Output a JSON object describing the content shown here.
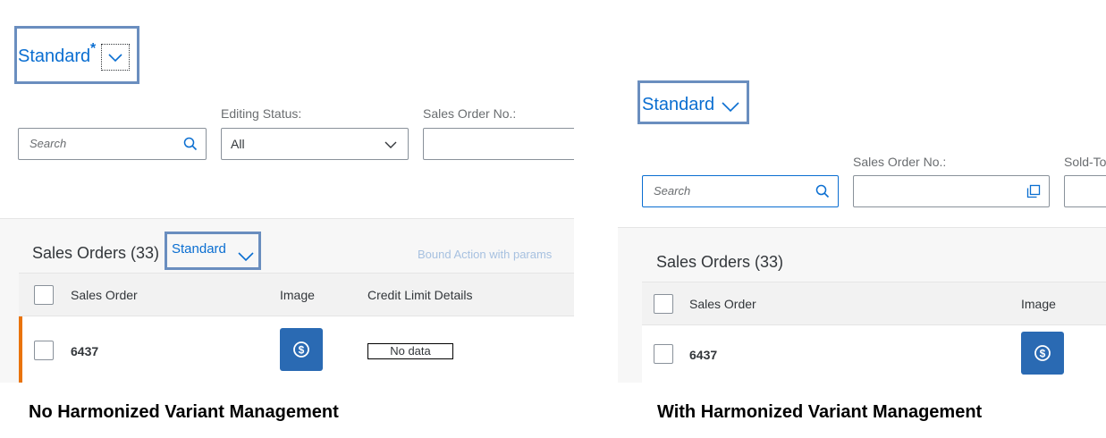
{
  "left": {
    "variant": {
      "title": "Standard",
      "dirty_marker": "*"
    },
    "search": {
      "placeholder": "Search"
    },
    "filters": {
      "editing_status": {
        "label": "Editing Status:",
        "value": "All"
      },
      "sales_order_no": {
        "label": "Sales Order No.:"
      }
    },
    "table": {
      "title": "Sales Orders (33)",
      "variant_title": "Standard",
      "action": "Bound Action with params",
      "columns": [
        "Sales Order",
        "Image",
        "Credit Limit Details"
      ],
      "rows": [
        {
          "sales_order": "6437",
          "credit_limit": "No data"
        }
      ]
    },
    "caption": "No Harmonized Variant Management"
  },
  "right": {
    "variant": {
      "title": "Standard"
    },
    "search": {
      "placeholder": "Search"
    },
    "filters": {
      "sales_order_no": {
        "label": "Sales Order No.:"
      },
      "sold_to": {
        "label": "Sold-To"
      }
    },
    "table": {
      "title": "Sales Orders (33)",
      "columns": [
        "Sales Order",
        "Image"
      ],
      "rows": [
        {
          "sales_order": "6437"
        }
      ]
    },
    "caption": "With Harmonized Variant Management"
  },
  "colors": {
    "accent": "#0a6ed1",
    "highlight_border": "#6a8ebf",
    "image_button": "#2a6ab3",
    "row_marker": "#e9730c"
  },
  "icons": {
    "variant_dropdown": "chevron-down-icon",
    "search": "search-icon",
    "select": "chevron-down-icon",
    "value_help": "value-help-icon",
    "image": "dollar-coin-icon"
  }
}
